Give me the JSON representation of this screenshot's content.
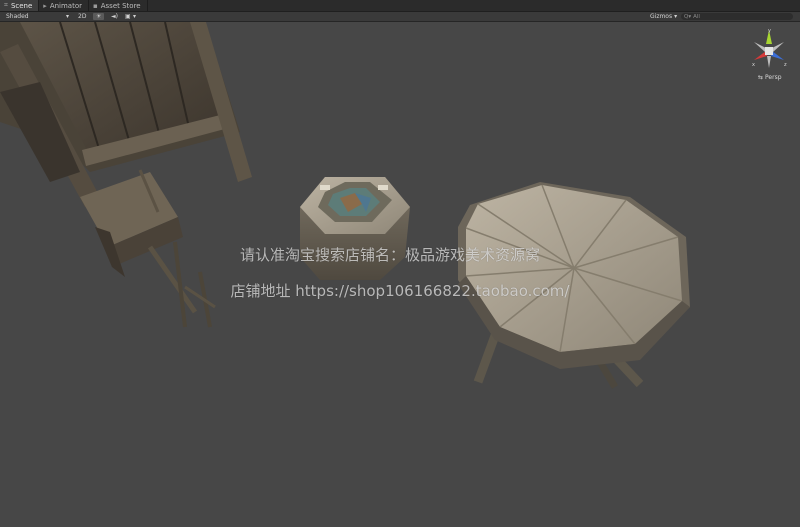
{
  "tabs": [
    {
      "label": "Scene",
      "icon": "scene-icon",
      "active": true
    },
    {
      "label": "Animator",
      "icon": "animator-icon",
      "active": false
    },
    {
      "label": "Asset Store",
      "icon": "asset-store-icon",
      "active": false
    }
  ],
  "toolbar": {
    "shading_mode": "Shaded",
    "mode_2d": "2D",
    "lighting_glyph": "☀",
    "audio_glyph": "◄)",
    "effects_glyph": "▣",
    "dropdown_glyph": "▾",
    "gizmos_label": "Gizmos",
    "search_placeholder": "All",
    "search_prefix": "Q▾"
  },
  "scene_gizmo": {
    "axis_y": "y",
    "axis_x": "x",
    "axis_z": "z",
    "view_label": "Persp",
    "colors": {
      "x": "#d43a3a",
      "y": "#a8d631",
      "z": "#3c6ed6"
    }
  },
  "watermark": {
    "line1": "请认准淘宝搜索店铺名：极品游戏美术资源窝",
    "line2": "店铺地址 https://shop106166822.taobao.com/"
  }
}
